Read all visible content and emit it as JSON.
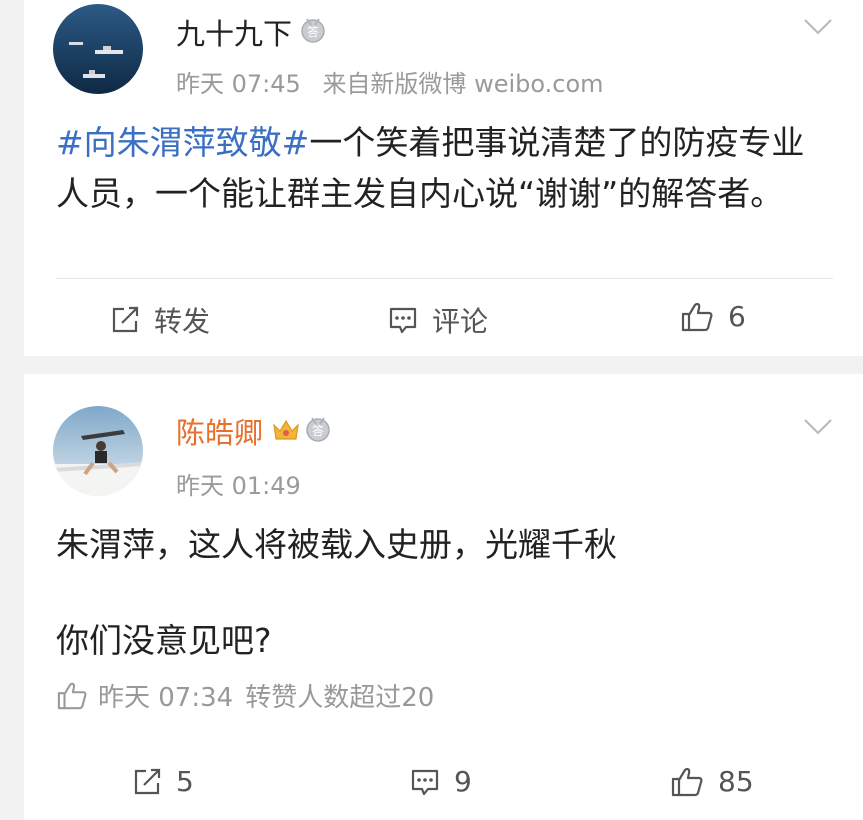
{
  "posts": [
    {
      "author": "九十九下",
      "time": "昨天 07:45",
      "source": "来自新版微博 weibo.com",
      "hashtag": "#向朱渭萍致敬#",
      "text": "一个笑着把事说清楚了的防疫专业人员，一个能让群主发自内心说“谢谢”的解答者。",
      "actions": {
        "repost": "转发",
        "comment": "评论",
        "like": "6"
      }
    },
    {
      "author": "陈皓卿",
      "author_color": "#e6702c",
      "time": "昨天 01:49",
      "text_line1": "朱渭萍，这人将被载入史册，光耀千秋",
      "text_line2": "你们没意见吧?",
      "liked_by": {
        "time": "昨天 07:34",
        "text": "转赞人数超过20"
      },
      "actions": {
        "repost": "5",
        "comment": "9",
        "like": "85"
      }
    }
  ],
  "icons": {
    "medal": "medal-icon",
    "crown": "crown-icon",
    "repost": "repost-icon",
    "comment": "comment-icon",
    "like": "thumbs-up-icon",
    "more": "chevron-down-icon"
  }
}
